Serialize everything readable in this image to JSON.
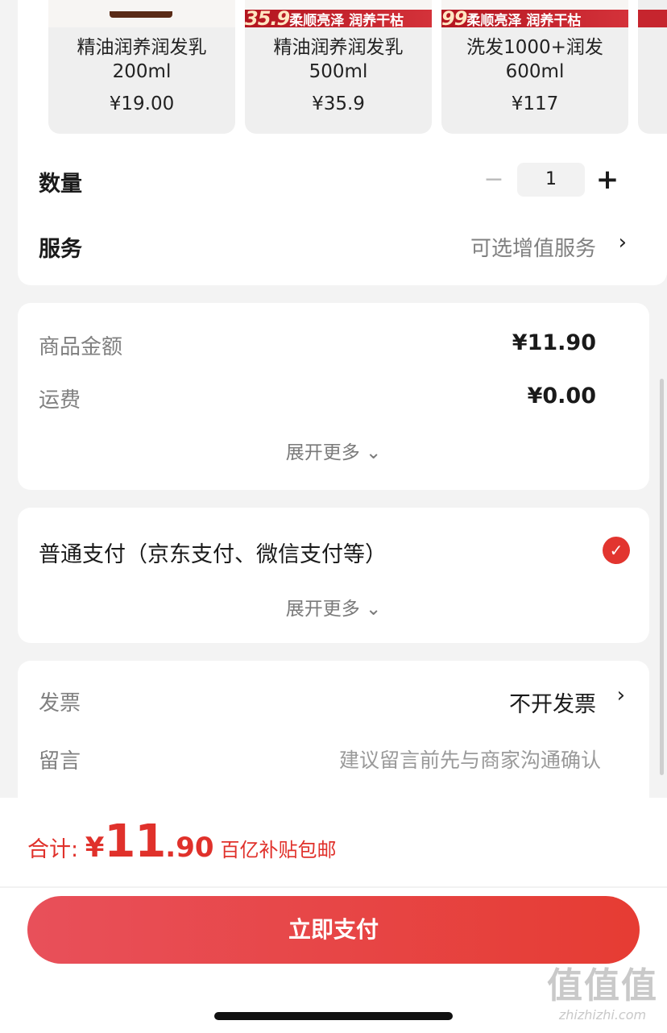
{
  "variants": [
    {
      "name_line1": "精油润养润发乳",
      "name_line2": "200ml",
      "price": "¥19.00",
      "banner_num": "",
      "banner_text": ""
    },
    {
      "name_line1": "精油润养润发乳",
      "name_line2": "500ml",
      "price": "¥35.9",
      "banner_num": "35.9",
      "banner_text": "柔顺亮泽 润养干枯"
    },
    {
      "name_line1": "洗发1000+润发",
      "name_line2": "600ml",
      "price": "¥117",
      "banner_num": "99",
      "banner_text": "柔顺亮泽 润养干枯"
    }
  ],
  "quantity": {
    "label": "数量",
    "minus": "−",
    "value": "1",
    "plus": "+"
  },
  "service": {
    "label": "服务",
    "value": "可选增值服务",
    "chevron": "›"
  },
  "amounts": {
    "goods_label": "商品金额",
    "goods_value": "¥11.90",
    "shipping_label": "运费",
    "shipping_value": "¥0.00",
    "expand": "展开更多 ⌄"
  },
  "payment": {
    "label": "普通支付（京东支付、微信支付等）",
    "check": "✓",
    "expand": "展开更多 ⌄"
  },
  "invoice": {
    "label": "发票",
    "value": "不开发票",
    "chevron": "›"
  },
  "note": {
    "label": "留言",
    "placeholder": "建议留言前先与商家沟通确认"
  },
  "total": {
    "label": "合计: ",
    "currency": "¥",
    "integer": "11",
    "decimal": ".90",
    "tag": "百亿补贴包邮"
  },
  "pay_button": "立即支付",
  "watermark": {
    "big": "值值值",
    "small": "zhizhizhi.com"
  },
  "colors": {
    "accent": "#e2352f",
    "background": "#f3f3f3"
  }
}
